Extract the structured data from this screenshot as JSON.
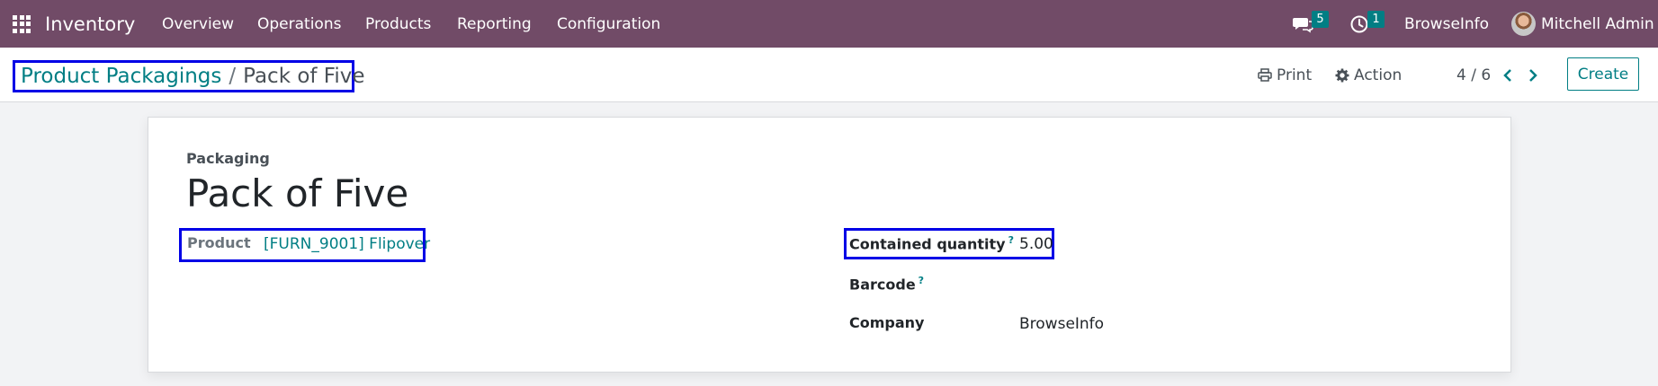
{
  "navbar": {
    "app_name": "Inventory",
    "menu": [
      "Overview",
      "Operations",
      "Products",
      "Reporting",
      "Configuration"
    ],
    "messages_count": "5",
    "activities_count": "1",
    "company": "BrowseInfo",
    "user": "Mitchell Admin",
    "bg_color": "#714b67"
  },
  "control_panel": {
    "breadcrumb_parent": "Product Packagings",
    "breadcrumb_separator": "/",
    "breadcrumb_current": "Pack of Five",
    "print_label": "Print",
    "action_label": "Action",
    "pager": "4 / 6",
    "create_label": "Create"
  },
  "form": {
    "section_label": "Packaging",
    "name": "Pack of Five",
    "product_label": "Product",
    "product_value": "[FURN_9001] Flipover",
    "qty_label": "Contained quantity",
    "qty_help": "?",
    "qty_value": "5.00",
    "barcode_label": "Barcode",
    "barcode_help": "?",
    "company_label": "Company",
    "company_value": "BrowseInfo"
  },
  "colors": {
    "accent": "#017e84",
    "highlight_box": "#0000e6"
  }
}
